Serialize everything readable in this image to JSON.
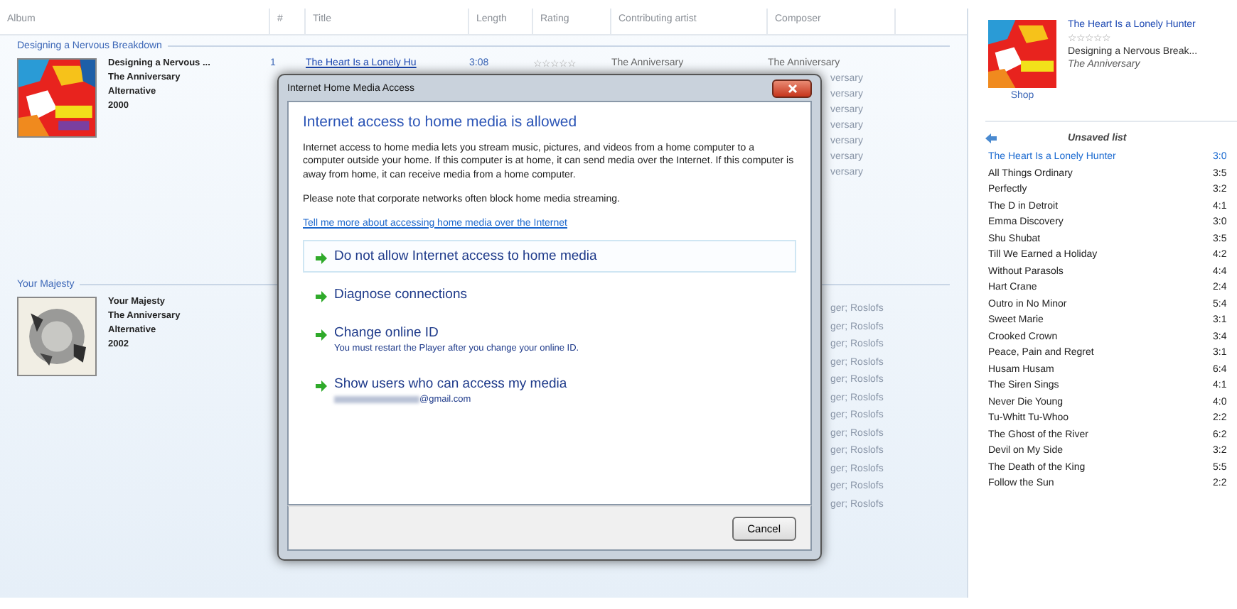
{
  "library": {
    "columns": [
      "Album",
      "#",
      "Title",
      "Length",
      "Rating",
      "Contributing artist",
      "Composer"
    ],
    "groups": [
      {
        "heading": "Designing a Nervous Breakdown",
        "album": "Designing a Nervous ...",
        "artist": "The Anniversary",
        "genre": "Alternative",
        "year": "2000"
      },
      {
        "heading": "Your Majesty",
        "album": "Your Majesty",
        "artist": "The Anniversary",
        "genre": "Alternative",
        "year": "2002"
      }
    ],
    "first_row": {
      "number": "1",
      "title": "The Heart Is a Lonely Hu",
      "length": "3:08",
      "stars": 0,
      "artist": "The Anniversary",
      "composer": "The Anniversary"
    },
    "composer_fragments_top": [
      "versary",
      "versary",
      "versary",
      "versary",
      "versary",
      "versary",
      "versary"
    ],
    "composer_fragments_bottom": [
      "ger; Roslofs",
      "ger; Roslofs",
      "ger; Roslofs",
      "ger; Roslofs",
      "ger; Roslofs",
      "ger; Roslofs",
      "ger; Roslofs",
      "ger; Roslofs",
      "ger; Roslofs",
      "ger; Roslofs",
      "ger; Roslofs",
      "ger; Roslofs"
    ]
  },
  "now_playing": {
    "title": "The Heart Is a Lonely Hunter",
    "stars": 0,
    "album": "Designing a Nervous Break...",
    "artist": "The Anniversary",
    "shop": "Shop"
  },
  "playlist": {
    "title": "Unsaved list",
    "items": [
      {
        "title": "The Heart Is a Lonely Hunter",
        "length": "3:0",
        "selected": true
      },
      {
        "title": "All Things Ordinary",
        "length": "3:5",
        "selected": false
      },
      {
        "title": "Perfectly",
        "length": "3:2",
        "selected": false
      },
      {
        "title": "The D in Detroit",
        "length": "4:1",
        "selected": false
      },
      {
        "title": "Emma Discovery",
        "length": "3:0",
        "selected": false
      },
      {
        "title": "Shu Shubat",
        "length": "3:5",
        "selected": false
      },
      {
        "title": "Till We Earned a Holiday",
        "length": "4:2",
        "selected": false
      },
      {
        "title": "Without Parasols",
        "length": "4:4",
        "selected": false
      },
      {
        "title": "Hart Crane",
        "length": "2:4",
        "selected": false
      },
      {
        "title": "Outro in No Minor",
        "length": "5:4",
        "selected": false
      },
      {
        "title": "Sweet Marie",
        "length": "3:1",
        "selected": false
      },
      {
        "title": "Crooked Crown",
        "length": "3:4",
        "selected": false
      },
      {
        "title": "Peace, Pain and Regret",
        "length": "3:1",
        "selected": false
      },
      {
        "title": "Husam Husam",
        "length": "6:4",
        "selected": false
      },
      {
        "title": "The Siren Sings",
        "length": "4:1",
        "selected": false
      },
      {
        "title": "Never Die Young",
        "length": "4:0",
        "selected": false
      },
      {
        "title": "Tu-Whitt Tu-Whoo",
        "length": "2:2",
        "selected": false
      },
      {
        "title": "The Ghost of the River",
        "length": "6:2",
        "selected": false
      },
      {
        "title": "Devil on My Side",
        "length": "3:2",
        "selected": false
      },
      {
        "title": "The Death of the King",
        "length": "5:5",
        "selected": false
      },
      {
        "title": "Follow the Sun",
        "length": "2:2",
        "selected": false
      }
    ]
  },
  "dialog": {
    "title": "Internet Home Media Access",
    "heading": "Internet access to home media is allowed",
    "paragraphs": [
      "Internet access to home media lets you stream music, pictures, and videos from a home computer to a computer outside your home.  If this computer is at home, it can send media over the Internet.  If this computer is away from home, it can receive media from a home computer.",
      "Please note that corporate networks often block home media streaming."
    ],
    "link": "Tell me more about accessing home media over the Internet",
    "options": [
      {
        "label": "Do not allow Internet access to home media",
        "selected": true,
        "kind": "plain"
      },
      {
        "label": "Diagnose connections",
        "selected": false,
        "kind": "plain"
      },
      {
        "label": "Change online ID",
        "note": "You must restart the Player after you change your online ID.",
        "selected": false,
        "kind": "note"
      },
      {
        "label": "Show users who can access my media",
        "note": "@gmail.com",
        "selected": false,
        "kind": "email"
      }
    ],
    "cancel": "Cancel"
  }
}
